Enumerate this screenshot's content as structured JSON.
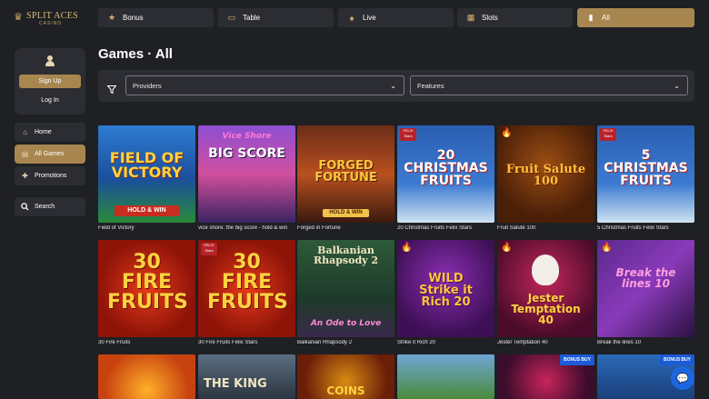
{
  "brand": {
    "name": "SPLIT ACES",
    "sub": "CASINO"
  },
  "tabs": [
    {
      "label": "Bonus",
      "icon": "star-icon",
      "active": false
    },
    {
      "label": "Table",
      "icon": "chip-icon",
      "active": false
    },
    {
      "label": "Live",
      "icon": "spade-icon",
      "active": false
    },
    {
      "label": "Slots",
      "icon": "slot-icon",
      "active": false
    },
    {
      "label": "All",
      "icon": "card-icon",
      "active": true
    }
  ],
  "account": {
    "signup_label": "Sign Up",
    "login_label": "Log In"
  },
  "sidebar": [
    {
      "label": "Home",
      "icon": "home-icon",
      "active": false
    },
    {
      "label": "All Games",
      "icon": "games-icon",
      "active": true
    },
    {
      "label": "Promotions",
      "icon": "gift-icon",
      "active": false
    },
    {
      "label": "Search",
      "icon": "search-icon",
      "active": false
    }
  ],
  "page_title": "Games · All",
  "filters": {
    "providers_label": "Providers",
    "features_label": "Features"
  },
  "games": [
    {
      "title": "Field of Victory",
      "art": "FIELD OF VICTORY",
      "sub": "HOLD & WIN"
    },
    {
      "title": "vice shore: the big score - hold & win",
      "art": "BIG SCORE",
      "sub": "Vice Shore"
    },
    {
      "title": "Forged in Fortune",
      "art": "FORGED FORTUNE",
      "sub": "HOLD & WIN"
    },
    {
      "title": "20 Christmas Fruits Felix Stars",
      "art": "20 CHRISTMAS FRUITS",
      "sub": ""
    },
    {
      "title": "Fruit Salute 100",
      "art": "Fruit Salute 100",
      "sub": ""
    },
    {
      "title": "5 Christmas Fruits Felix Stars",
      "art": "5 CHRISTMAS FRUITS",
      "sub": ""
    },
    {
      "title": "30 Fire Fruits",
      "art": "30 FIRE FRUITS",
      "sub": ""
    },
    {
      "title": "30 Fire Fruits Felix Stars",
      "art": "30 FIRE FRUITS",
      "sub": ""
    },
    {
      "title": "Balkanian Rhapsody 2",
      "art": "Balkanian Rhapsody 2",
      "sub": "An Ode to Love"
    },
    {
      "title": "Strike it Rich 20",
      "art": "WILD Strike it Rich 20",
      "sub": ""
    },
    {
      "title": "Jester Temptation 40",
      "art": "Jester Temptation 40",
      "sub": ""
    },
    {
      "title": "Break the lines 10",
      "art": "Break the lines 10",
      "sub": ""
    },
    {
      "title": "",
      "art": "",
      "sub": ""
    },
    {
      "title": "",
      "art": "THE KING",
      "sub": ""
    },
    {
      "title": "",
      "art": "COINS",
      "sub": ""
    },
    {
      "title": "",
      "art": "",
      "sub": ""
    },
    {
      "title": "",
      "art": "",
      "sub": "BONUS BUY"
    },
    {
      "title": "",
      "art": "",
      "sub": "BONUS BUY"
    }
  ],
  "badges": {
    "felix": "FELIX Stars",
    "bonus_buy": "BONUS BUY"
  }
}
